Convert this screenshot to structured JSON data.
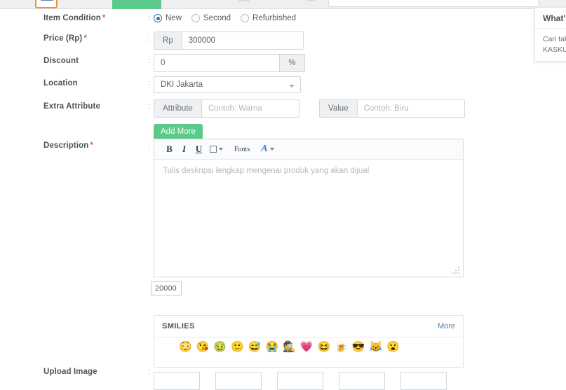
{
  "top_bar": {
    "logo_name": "kaskus-logo-icon",
    "green_tab_name": "jual-tab",
    "search_placeholder": ""
  },
  "form": {
    "item_condition": {
      "label": "Item Condition",
      "required": true,
      "colon": ":",
      "options": [
        {
          "label": "New",
          "selected": true
        },
        {
          "label": "Second",
          "selected": false
        },
        {
          "label": "Refurbished",
          "selected": false
        }
      ]
    },
    "price": {
      "label": "Price (Rp)",
      "required": true,
      "colon": ":",
      "prefix": "Rp",
      "value": "300000"
    },
    "discount": {
      "label": "Discount",
      "required": false,
      "colon": ":",
      "value": "0",
      "suffix": "%"
    },
    "location": {
      "label": "Location",
      "required": false,
      "colon": ":",
      "value": "DKI Jakarta"
    },
    "extra_attribute": {
      "label": "Extra Attribute",
      "required": false,
      "colon": ":",
      "attribute_addon": "Attribute",
      "attribute_placeholder": "Contoh: Warna",
      "value_addon": "Value",
      "value_placeholder": "Contoh: Biru",
      "add_more_label": "Add More"
    },
    "description": {
      "label": "Description",
      "required": true,
      "colon": ":",
      "placeholder": "Tulis deskripsi lengkap mengenai produk yang akan dijual",
      "char_counter": "20000",
      "toolbar": [
        {
          "name": "bold-icon",
          "glyph": "B"
        },
        {
          "name": "italic-icon",
          "glyph": "I"
        },
        {
          "name": "underline-icon",
          "glyph": "U"
        },
        {
          "name": "highlight-color-icon",
          "glyph": ""
        },
        {
          "name": "fonts-icon",
          "glyph": "Fonts"
        },
        {
          "name": "text-color-icon",
          "glyph": "A"
        }
      ]
    },
    "smilies": {
      "title": "SMILIES",
      "more_label": "More",
      "items": [
        {
          "name": "smiley-malu",
          "glyph": "😳"
        },
        {
          "name": "smiley-kiss",
          "glyph": "😘"
        },
        {
          "name": "smiley-sick",
          "glyph": "🤢"
        },
        {
          "name": "smiley-happy",
          "glyph": "🙂"
        },
        {
          "name": "smiley-sweat",
          "glyph": "😅"
        },
        {
          "name": "smiley-cry",
          "glyph": "😭"
        },
        {
          "name": "smiley-cool-hat",
          "glyph": "🕵"
        },
        {
          "name": "smiley-love",
          "glyph": "💗"
        },
        {
          "name": "smiley-laugh",
          "glyph": "😆"
        },
        {
          "name": "smiley-cendol",
          "glyph": "🍺"
        },
        {
          "name": "smiley-hammer",
          "glyph": "😎"
        },
        {
          "name": "smiley-ngakak",
          "glyph": "😹"
        },
        {
          "name": "smiley-shock",
          "glyph": "😮"
        }
      ]
    },
    "upload_image": {
      "label": "Upload Image",
      "required": false,
      "colon": ":",
      "slots": 5
    }
  },
  "promo_panel": {
    "title": "What's",
    "line1": "Cari tah",
    "line2": "KASKUS"
  },
  "colors": {
    "accent_green": "#5bc98a",
    "required_red": "#e2556a",
    "radio_blue": "#2f6fb0",
    "link_blue": "#5b7fa6"
  }
}
